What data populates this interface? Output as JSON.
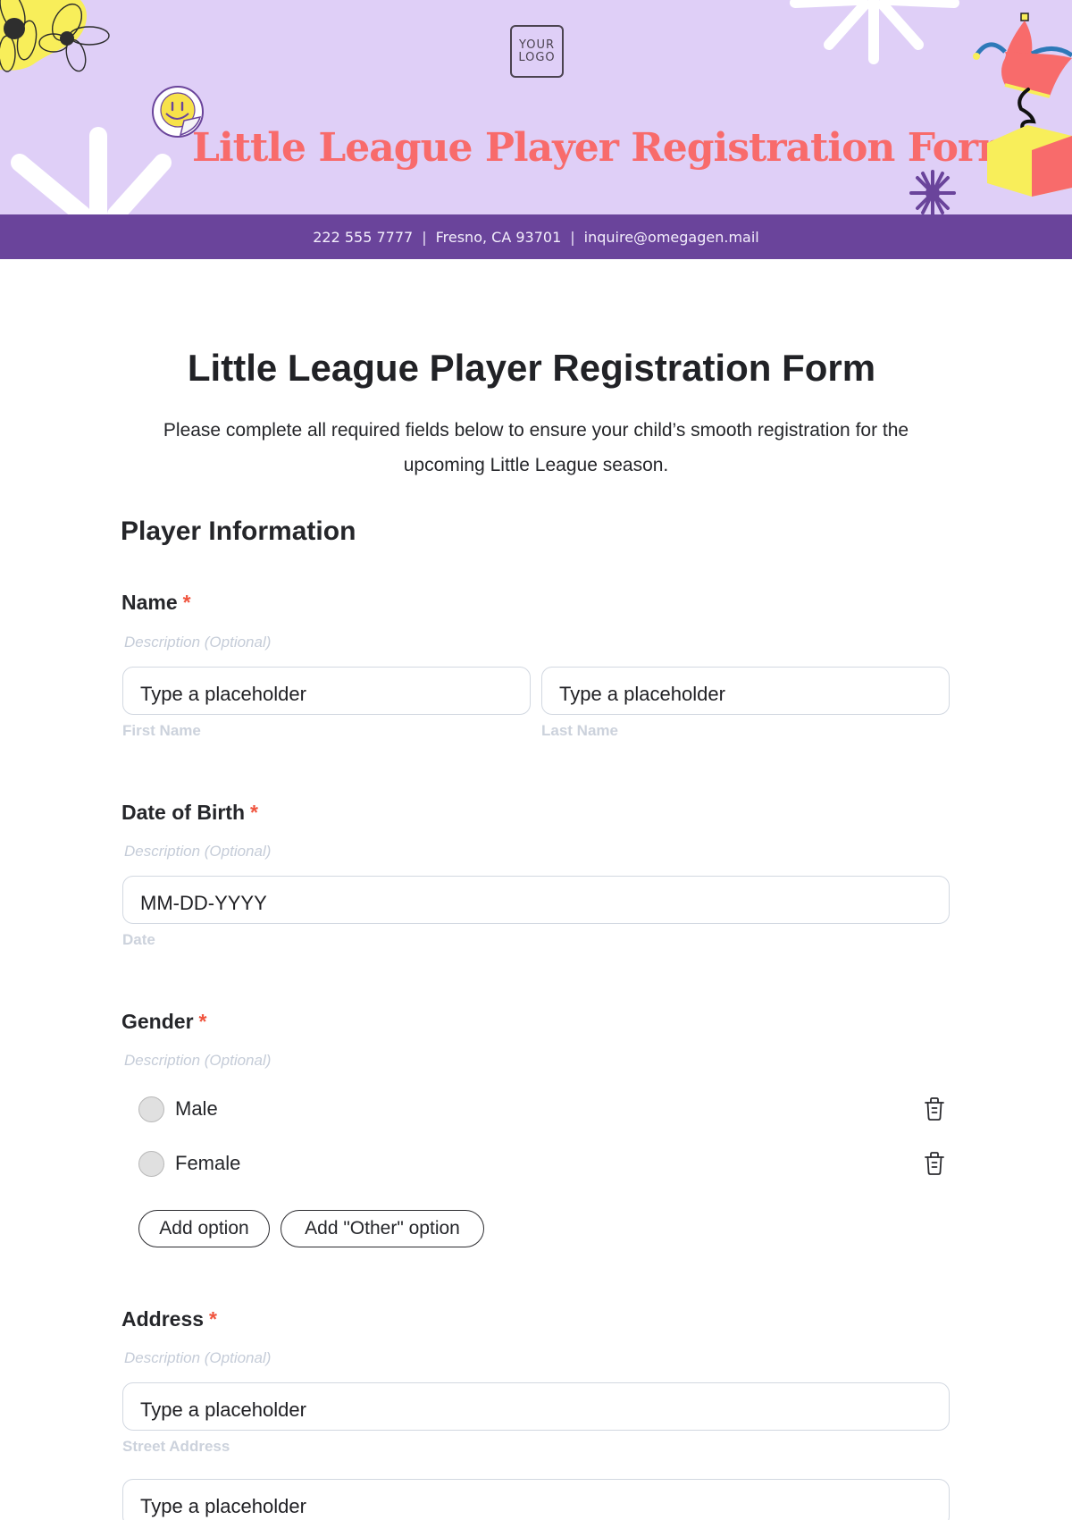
{
  "banner": {
    "logo_line1": "YOUR",
    "logo_line2": "LOGO",
    "title": "Little League Player Registration Form",
    "colors": {
      "background": "#dfcff7",
      "title": "#f86b6b",
      "bar": "#6a449b"
    }
  },
  "contact": {
    "phone": "222 555 7777",
    "location": "Fresno, CA 93701",
    "email": "inquire@omegagen.mail",
    "separator": "|"
  },
  "form": {
    "title": "Little League Player Registration Form",
    "description": "Please complete all required fields below to ensure your child’s smooth registration for the upcoming Little League season.",
    "section_title": "Player Information",
    "required_mark": "*",
    "questions": {
      "name": {
        "label": "Name",
        "description": "Description (Optional)",
        "first": {
          "placeholder": "Type a placeholder",
          "sublabel": "First Name"
        },
        "last": {
          "placeholder": "Type a placeholder",
          "sublabel": "Last Name"
        }
      },
      "dob": {
        "label": "Date of Birth",
        "description": "Description (Optional)",
        "placeholder": "MM-DD-YYYY",
        "sublabel": "Date"
      },
      "gender": {
        "label": "Gender",
        "description": "Description (Optional)",
        "options": [
          {
            "label": "Male",
            "selected": false
          },
          {
            "label": "Female",
            "selected": false
          }
        ],
        "add_option": "Add option",
        "add_other_option": "Add \"Other\" option"
      },
      "address": {
        "label": "Address",
        "description": "Description (Optional)",
        "street": {
          "placeholder": "Type a placeholder",
          "sublabel": "Street Address"
        },
        "line2": {
          "placeholder": "Type a placeholder"
        }
      }
    }
  }
}
